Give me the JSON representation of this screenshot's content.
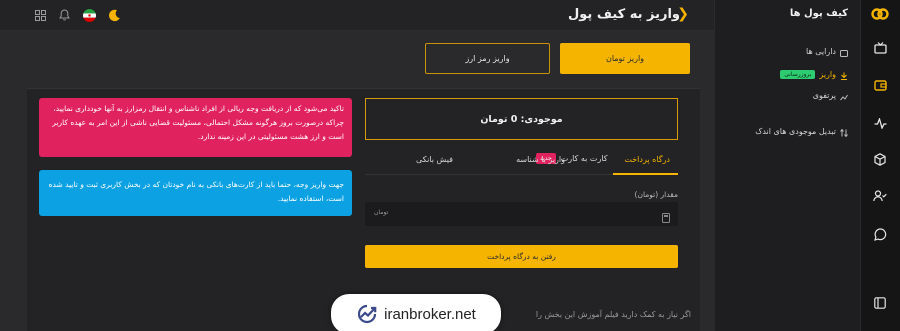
{
  "header": {
    "title": "واریز به کیف پول",
    "icons": [
      "moon-icon",
      "iran-flag-icon",
      "bell-icon",
      "apps-grid-icon"
    ]
  },
  "sidebar": {
    "title": "کیف پول ها",
    "items": [
      {
        "label": "دارایی ها",
        "icon": "wallet-icon"
      },
      {
        "label": "واریز",
        "badge": "بروزرسانی",
        "icon": "deposit-icon",
        "active": true
      },
      {
        "label": "پرتفوی",
        "icon": "chart-icon"
      },
      {
        "label": "تبدیل موجودی های اندک",
        "icon": "convert-icon"
      }
    ]
  },
  "rail": {
    "icons": [
      "logo-icon",
      "tv-icon",
      "wallet-icon",
      "pulse-icon",
      "cube-icon",
      "user-check-icon",
      "chat-icon",
      "sidebar-toggle-icon"
    ]
  },
  "deposit_type": {
    "toman": "واریز تومان",
    "crypto": "واریز رمز ارز"
  },
  "alerts": {
    "red": "تاکید می‌شود که از دریافت وجه ریالی از افراد ناشناس و انتقال رمزارز به آنها خودداری نمایید، چراکه درصورت بروز هرگونه مشکل احتمالی، مسئولیت قضایی ناشی از این امر به عهده کاربر است و ارز هشت مسئولیتی در این زمینه ندارد.",
    "blue": "جهت واریز وجه، حتما باید از کارت‌های بانکی به نام خودتان که در بخش کاربری ثبت و تایید شده است، استفاده نمایید."
  },
  "balance": "موجودی: 0 تومان",
  "payment_tabs": [
    {
      "label": "درگاه پرداخت",
      "active": true
    },
    {
      "label": "کارت به کارت",
      "badge": "جدید"
    },
    {
      "label": "واریز با شناسه"
    },
    {
      "label": "فیش بانکی"
    }
  ],
  "amount": {
    "label": "مقدار (تومان)",
    "unit": "تومان"
  },
  "submit_label": "رفتن به درگاه پرداخت",
  "help_text": "اگر نیاز به کمک دارید فیلم آموزش این بخش را",
  "watermark": "iranbroker.net",
  "colors": {
    "accent": "#f5b400",
    "red": "#e0235f",
    "blue": "#0ba1e2",
    "badge_green": "#2ecc71"
  }
}
